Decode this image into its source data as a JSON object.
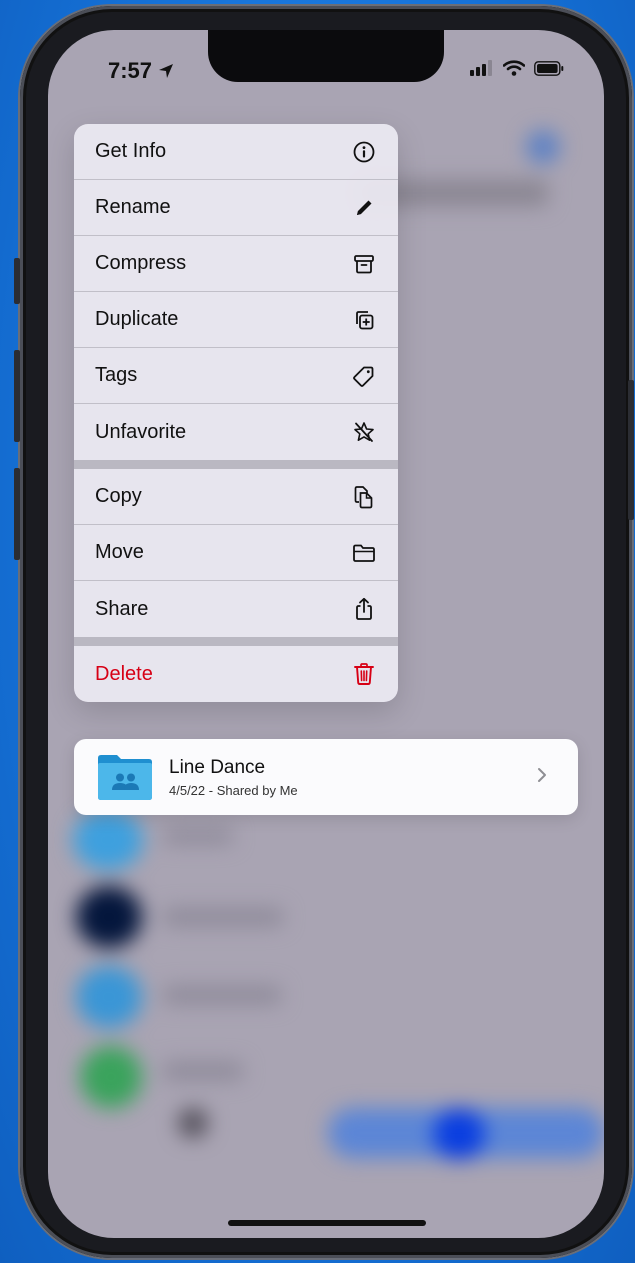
{
  "status_bar": {
    "time": "7:57"
  },
  "menu": {
    "group1": [
      {
        "label": "Get Info",
        "icon": "info-icon"
      },
      {
        "label": "Rename",
        "icon": "pencil-icon"
      },
      {
        "label": "Compress",
        "icon": "archive-icon"
      },
      {
        "label": "Duplicate",
        "icon": "duplicate-icon"
      },
      {
        "label": "Tags",
        "icon": "tag-icon"
      },
      {
        "label": "Unfavorite",
        "icon": "star-slash-icon"
      }
    ],
    "group2": [
      {
        "label": "Copy",
        "icon": "copy-icon"
      },
      {
        "label": "Move",
        "icon": "folder-icon"
      },
      {
        "label": "Share",
        "icon": "share-icon"
      }
    ],
    "group3": [
      {
        "label": "Delete",
        "icon": "trash-icon"
      }
    ]
  },
  "file": {
    "name": "Line Dance",
    "subtitle": "4/5/22 - Shared by Me",
    "icon": "shared-folder-icon"
  },
  "colors": {
    "destructive": "#d70015",
    "folder": "#34aadc",
    "background": "#1673d9"
  }
}
